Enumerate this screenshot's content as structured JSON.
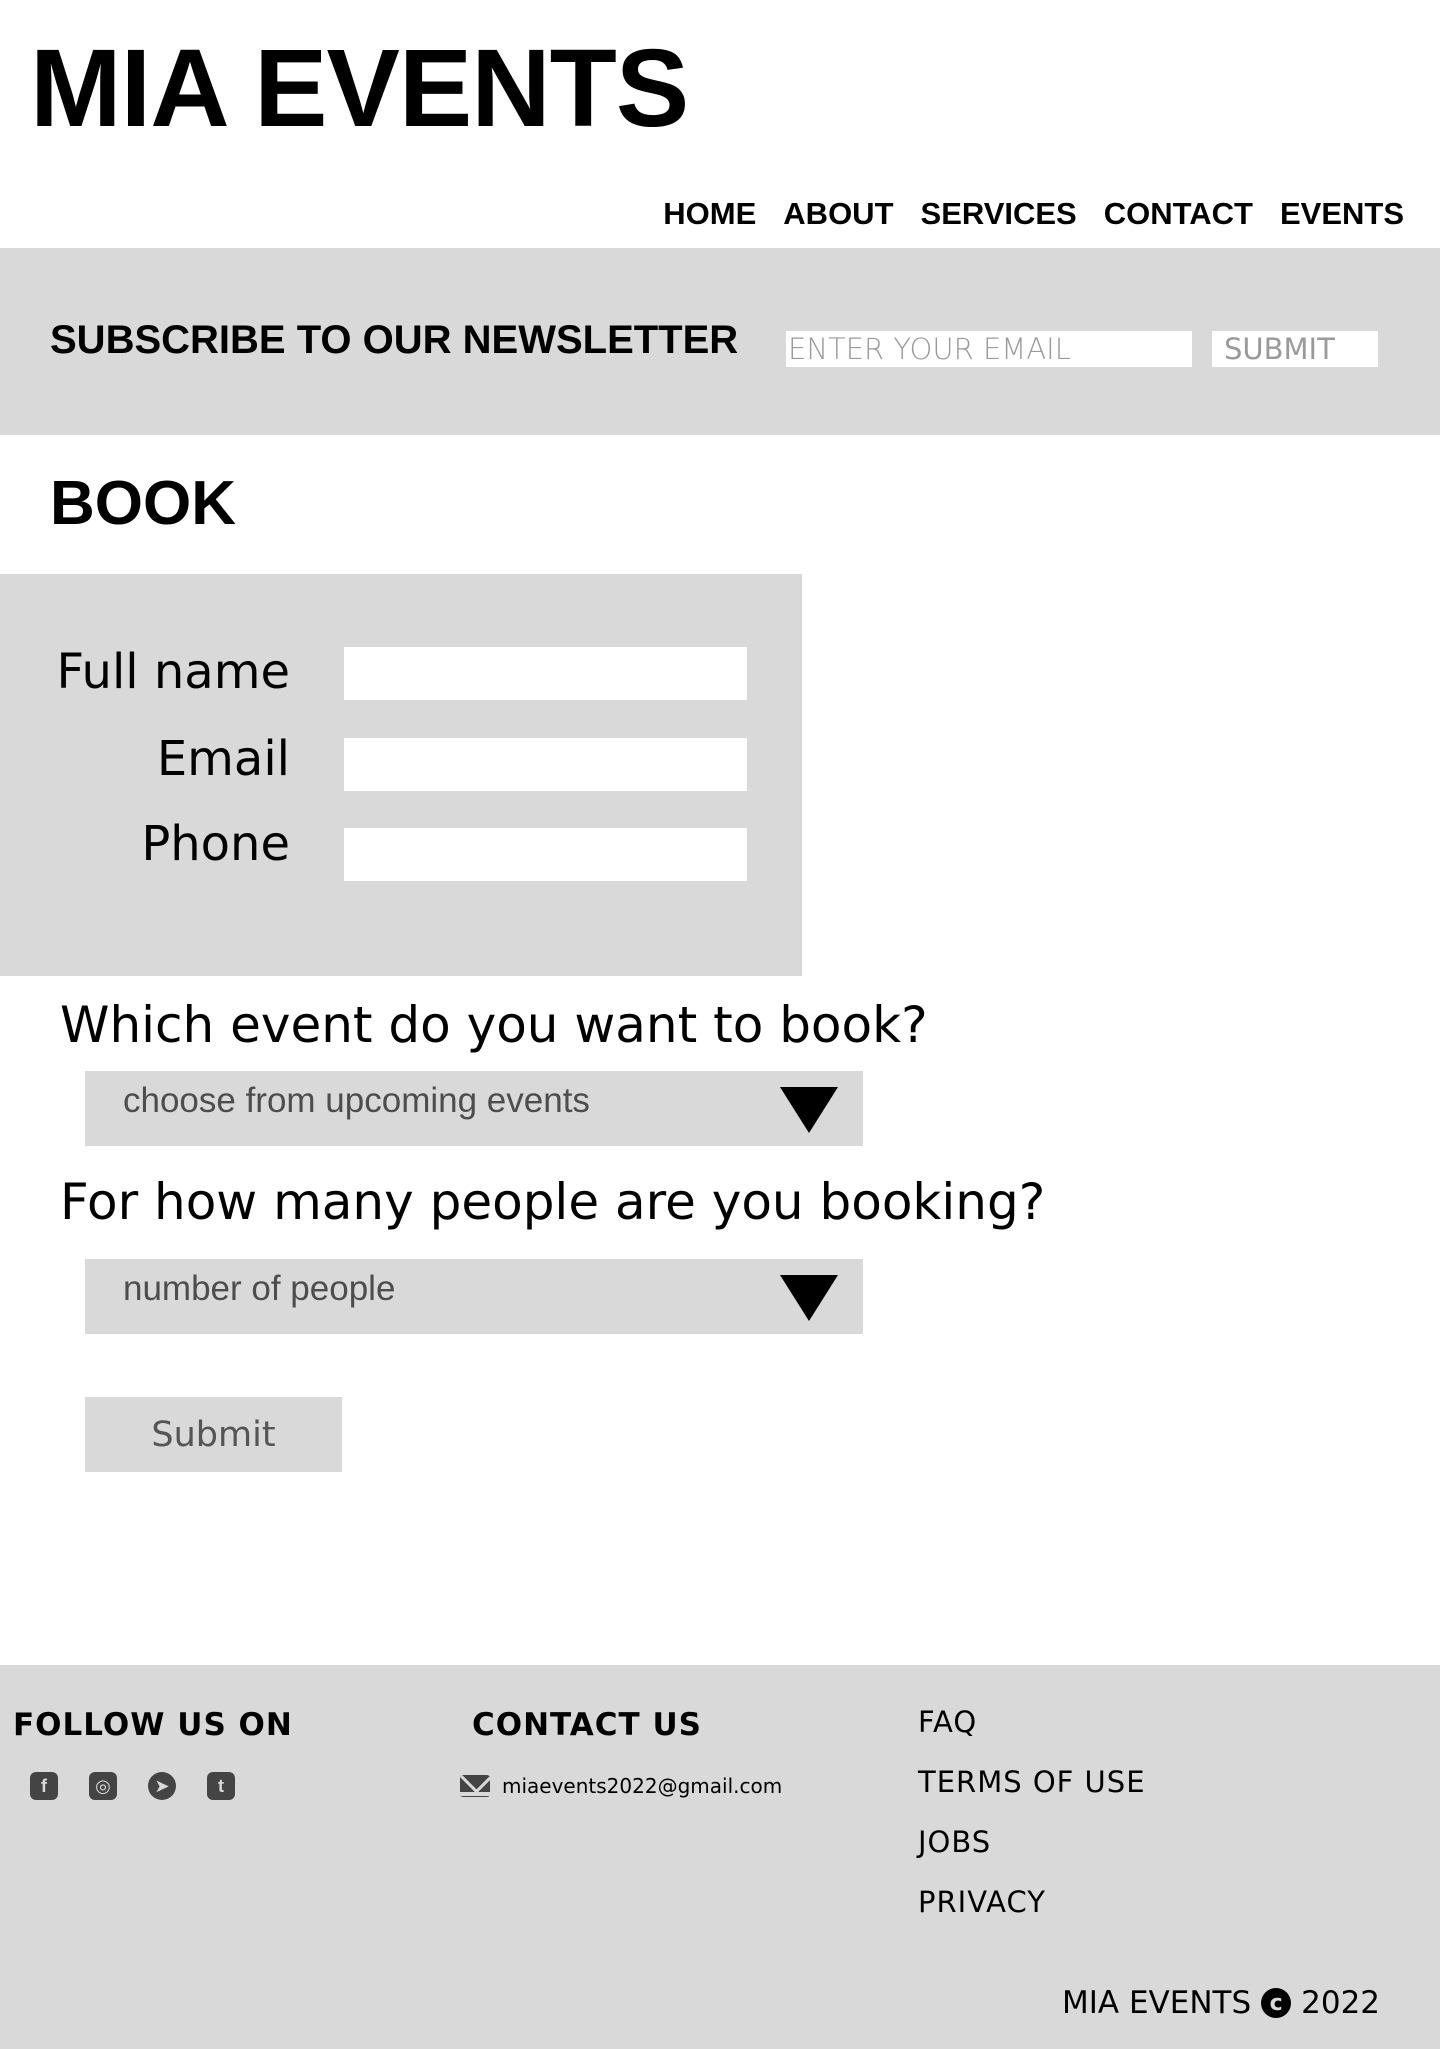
{
  "header": {
    "logo": "MIA EVENTS",
    "nav": [
      "HOME",
      "ABOUT",
      "SERVICES",
      "CONTACT",
      "EVENTS"
    ]
  },
  "newsletter": {
    "title": "SUBSCRIBE TO OUR NEWSLETTER",
    "email_placeholder": "ENTER YOUR EMAIL",
    "submit_label": "SUBMIT"
  },
  "book": {
    "title": "BOOK",
    "fields": {
      "full_name_label": "Full name",
      "email_label": "Email",
      "phone_label": "Phone"
    },
    "event_question": "Which event do you want to book?",
    "event_select_value": "choose from upcoming events",
    "people_question": "For how many people are you booking?",
    "people_select_value": "number of people",
    "submit_label": "Submit"
  },
  "footer": {
    "follow_heading": "FOLLOW US ON",
    "social_icons": [
      "facebook-icon",
      "instagram-icon",
      "telegram-icon",
      "twitter-icon"
    ],
    "contact_heading": "CONTACT US",
    "contact_email": "miaevents2022@gmail.com",
    "links": [
      "FAQ",
      "TERMS OF USE",
      "JOBS",
      "PRIVACY"
    ],
    "copyright_name": "MIA EVENTS",
    "copyright_year": "2022"
  }
}
